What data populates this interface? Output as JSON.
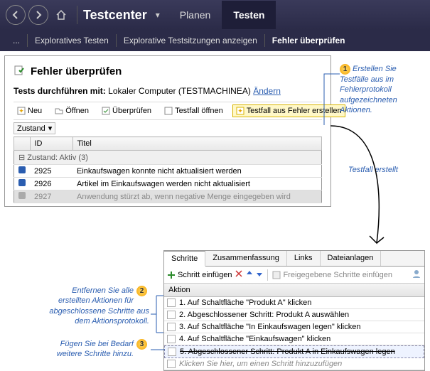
{
  "header": {
    "app_title": "Testcenter",
    "tab_plan": "Planen",
    "tab_test": "Testen"
  },
  "subnav": {
    "ellipsis": "...",
    "item1": "Exploratives Testen",
    "item2": "Explorative Testsitzungen anzeigen",
    "item3": "Fehler überprüfen"
  },
  "panel": {
    "title": "Fehler überprüfen",
    "run_label": "Tests durchführen mit:",
    "run_value": "Lokaler Computer (TESTMACHINEA)",
    "change": "Ändern"
  },
  "toolbar": {
    "neu": "Neu",
    "offnen": "Öffnen",
    "uberprufen": "Überprüfen",
    "testfall_offnen": "Testfall öffnen",
    "testfall_erstellen": "Testfall aus Fehler erstellen"
  },
  "zustand": "Zustand",
  "grid": {
    "col_id": "ID",
    "col_title": "Titel",
    "group": "Zustand: Aktiv (3)",
    "rows": [
      {
        "id": "2925",
        "title": "Einkaufswagen konnte nicht aktualisiert werden"
      },
      {
        "id": "2926",
        "title": "Artikel im Einkaufswagen werden nicht aktualisiert"
      },
      {
        "id": "2927",
        "title": "Anwendung stürzt ab, wenn negative Menge eingegeben wird"
      }
    ]
  },
  "callouts": {
    "c1": "Erstellen Sie Testfälle aus im Fehlerprotokoll aufgezeichneten Aktionen.",
    "c_mid": "Testfall erstellt",
    "c2": "Entfernen Sie alle erstellten Aktionen für abgeschlossene Schritte aus dem Aktionsprotokoll.",
    "c3": "Fügen Sie bei Bedarf weitere Schritte hinzu."
  },
  "steps": {
    "tab_schritte": "Schritte",
    "tab_zusammen": "Zusammenfassung",
    "tab_links": "Links",
    "tab_datei": "Dateianlagen",
    "tb_insert": "Schritt einfügen",
    "tb_shared": "Freigegebene Schritte einfügen",
    "action_head": "Aktion",
    "rows": [
      "1. Auf Schaltfläche \"Produkt A\" klicken",
      "2. Abgeschlossener Schritt: Produkt A auswählen",
      "3. Auf Schaltfläche \"In Einkaufswagen legen\" klicken",
      "4. Auf Schaltfläche \"Einkaufswagen\" klicken",
      "5. Abgeschlossener Schritt: Produkt A in Einkaufswagen legen"
    ],
    "hint": "Klicken Sie hier, um einen Schritt hinzuzufügen"
  }
}
